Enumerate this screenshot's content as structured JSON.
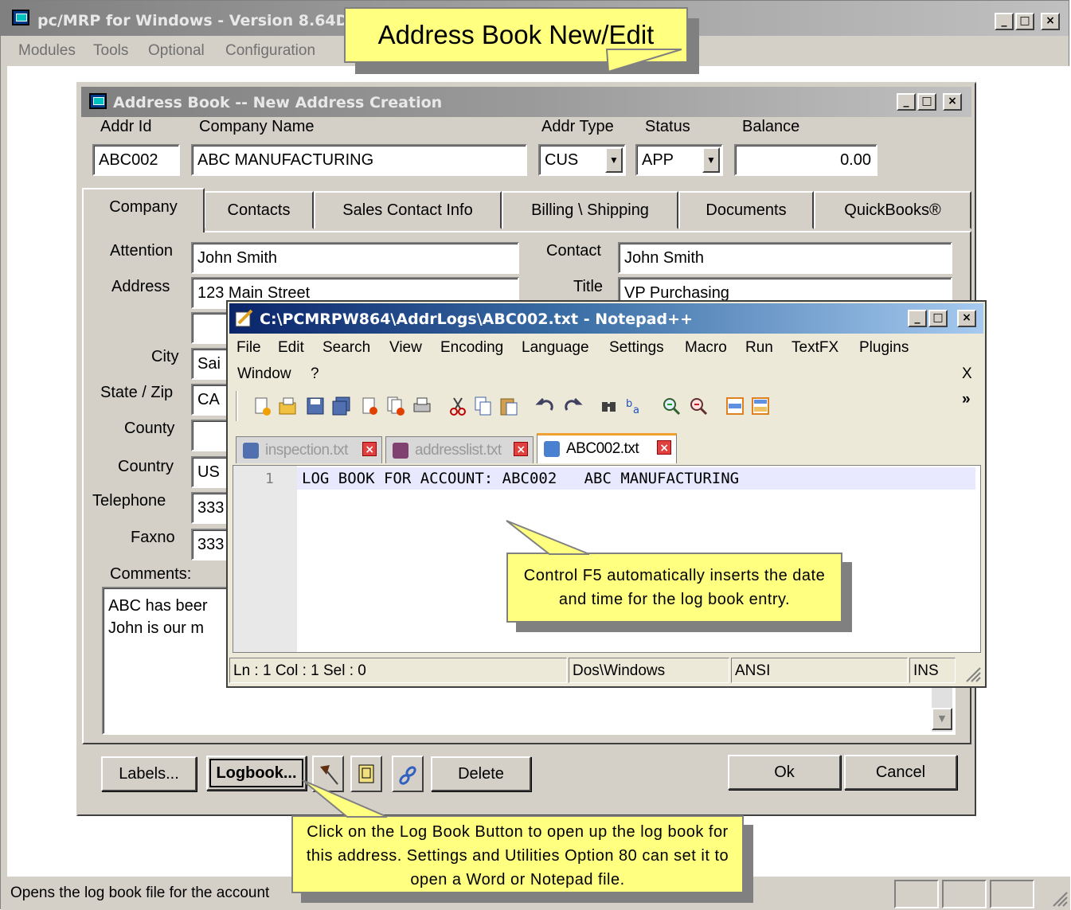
{
  "main_window": {
    "title": "pc/MRP for Windows - Version 8.64D",
    "menu": [
      "Modules",
      "Tools",
      "Optional",
      "Configuration"
    ],
    "status_text": "Opens the log book file for the account"
  },
  "callouts": {
    "title": "Address Book New/Edit",
    "ctrl_f5": "Control F5 automatically inserts the date and time for the log book entry.",
    "logbook": "Click on the Log Book Button to open up the log book for this address. Settings and Utilities Option 80 can set it to open a Word or Notepad file."
  },
  "address_book": {
    "title": "Address Book -- New Address Creation",
    "labels": {
      "addr_id": "Addr Id",
      "company_name": "Company Name",
      "addr_type": "Addr Type",
      "status": "Status",
      "balance": "Balance",
      "attention": "Attention",
      "address": "Address",
      "city": "City",
      "state_zip": "State / Zip",
      "county": "County",
      "country": "Country",
      "telephone": "Telephone",
      "faxno": "Faxno",
      "comments": "Comments:",
      "contact": "Contact",
      "title": "Title"
    },
    "values": {
      "addr_id": "ABC002",
      "company_name": "ABC MANUFACTURING",
      "addr_type": "CUS",
      "status": "APP",
      "balance": "0.00",
      "attention": "John Smith",
      "address1": "123 Main Street",
      "address2": "",
      "city": "Sai",
      "state": "CA",
      "county": "",
      "country": "US",
      "telephone": "333",
      "faxno": "333",
      "comments_line1": "ABC has beer",
      "comments_line2": "John is our m",
      "contact": "John Smith",
      "title": "VP Purchasing"
    },
    "tabs": [
      "Company",
      "Contacts",
      "Sales Contact Info",
      "Billing \\ Shipping",
      "Documents",
      "QuickBooks®"
    ],
    "buttons": {
      "labels": "Labels...",
      "logbook": "Logbook...",
      "delete": "Delete",
      "ok": "Ok",
      "cancel": "Cancel"
    }
  },
  "notepad": {
    "title": "C:\\PCMRPW864\\AddrLogs\\ABC002.txt - Notepad++",
    "menu_row1": [
      "File",
      "Edit",
      "Search",
      "View",
      "Encoding",
      "Language",
      "Settings",
      "Macro",
      "Run",
      "TextFX",
      "Plugins"
    ],
    "menu_row2": [
      "Window",
      "?"
    ],
    "close_x": "X",
    "overflow": "»",
    "tabs": [
      "inspection.txt",
      "addresslist.txt",
      "ABC002.txt"
    ],
    "line_number": "1",
    "line_text": "LOG BOOK FOR ACCOUNT: ABC002   ABC MANUFACTURING",
    "status": {
      "position": "Ln : 1    Col : 1    Sel : 0",
      "eol": "Dos\\Windows",
      "encoding": "ANSI",
      "mode": "INS"
    }
  }
}
